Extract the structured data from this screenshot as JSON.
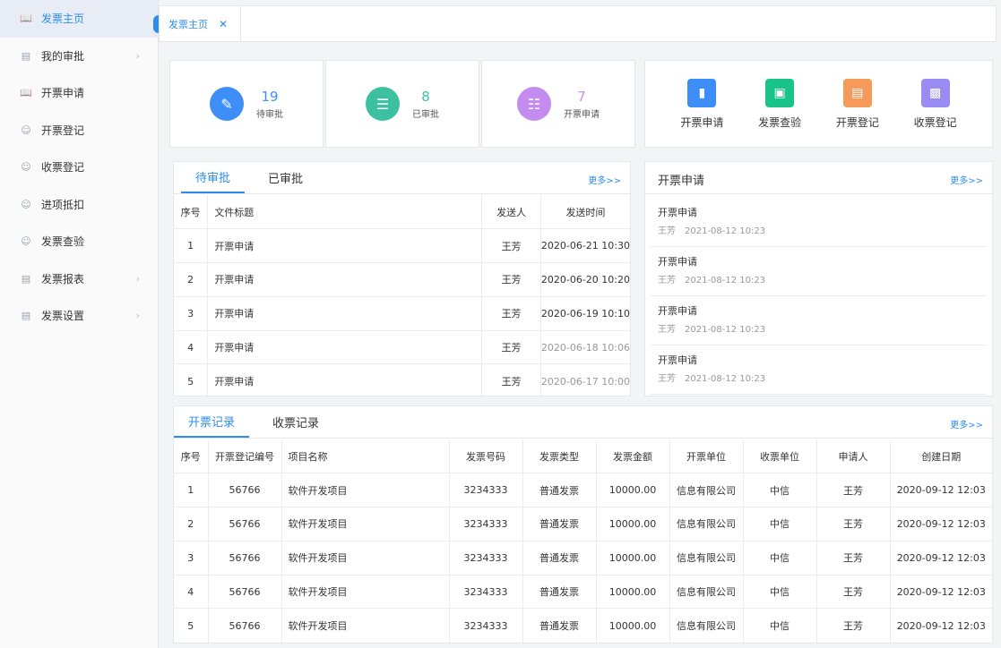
{
  "sidebar": {
    "items": [
      {
        "label": "发票主页",
        "icon": "book-icon",
        "active": true,
        "chevron": false
      },
      {
        "label": "我的审批",
        "icon": "doc-icon",
        "active": false,
        "chevron": true
      },
      {
        "label": "开票申请",
        "icon": "book-icon",
        "active": false,
        "chevron": false
      },
      {
        "label": "开票登记",
        "icon": "user-icon",
        "active": false,
        "chevron": false
      },
      {
        "label": "收票登记",
        "icon": "user-icon",
        "active": false,
        "chevron": false
      },
      {
        "label": "进项抵扣",
        "icon": "user-icon",
        "active": false,
        "chevron": false
      },
      {
        "label": "发票查验",
        "icon": "user-icon",
        "active": false,
        "chevron": false
      },
      {
        "label": "发票报表",
        "icon": "doc-icon",
        "active": false,
        "chevron": true
      },
      {
        "label": "发票设置",
        "icon": "doc-icon",
        "active": false,
        "chevron": true
      }
    ]
  },
  "tabs": [
    {
      "label": "发票主页",
      "close": "✕"
    }
  ],
  "stats": [
    {
      "value": "19",
      "label": "待审批",
      "color": "#3d8ef8"
    },
    {
      "value": "8",
      "label": "已审批",
      "color": "#3cc0a0"
    },
    {
      "value": "7",
      "label": "开票申请",
      "color": "#c58cf0"
    }
  ],
  "shortcuts": [
    {
      "label": "开票申请",
      "color": "#3d8ef8"
    },
    {
      "label": "发票查验",
      "color": "#19c38a"
    },
    {
      "label": "开票登记",
      "color": "#f59a5b"
    },
    {
      "label": "收票登记",
      "color": "#9b8cf5"
    }
  ],
  "approval": {
    "tabs": [
      "待审批",
      "已审批"
    ],
    "more": "更多>>",
    "headers": [
      "序号",
      "文件标题",
      "发送人",
      "发送时间"
    ],
    "rows": [
      [
        "1",
        "开票申请",
        "王芳",
        "2020-06-21 10:30"
      ],
      [
        "2",
        "开票申请",
        "王芳",
        "2020-06-20 10:20"
      ],
      [
        "3",
        "开票申请",
        "王芳",
        "2020-06-19 10:10"
      ],
      [
        "4",
        "开票申请",
        "王芳",
        "2020-06-18 10:06"
      ],
      [
        "5",
        "开票申请",
        "王芳",
        "2020-06-17 10:00"
      ]
    ]
  },
  "apply": {
    "title": "开票申请",
    "more": "更多>>",
    "items": [
      {
        "title": "开票申请",
        "user": "王芳",
        "time": "2021-08-12 10:23"
      },
      {
        "title": "开票申请",
        "user": "王芳",
        "time": "2021-08-12 10:23"
      },
      {
        "title": "开票申请",
        "user": "王芳",
        "time": "2021-08-12 10:23"
      },
      {
        "title": "开票申请",
        "user": "王芳",
        "time": "2021-08-12 10:23"
      }
    ]
  },
  "records": {
    "tabs": [
      "开票记录",
      "收票记录"
    ],
    "more": "更多>>",
    "headers": [
      "序号",
      "开票登记编号",
      "项目名称",
      "发票号码",
      "发票类型",
      "发票金额",
      "开票单位",
      "收票单位",
      "申请人",
      "创建日期"
    ],
    "rows": [
      [
        "1",
        "56766",
        "软件开发项目",
        "3234333",
        "普通发票",
        "10000.00",
        "信息有限公司",
        "中信",
        "王芳",
        "2020-09-12  12:03"
      ],
      [
        "2",
        "56766",
        "软件开发项目",
        "3234333",
        "普通发票",
        "10000.00",
        "信息有限公司",
        "中信",
        "王芳",
        "2020-09-12  12:03"
      ],
      [
        "3",
        "56766",
        "软件开发项目",
        "3234333",
        "普通发票",
        "10000.00",
        "信息有限公司",
        "中信",
        "王芳",
        "2020-09-12  12:03"
      ],
      [
        "4",
        "56766",
        "软件开发项目",
        "3234333",
        "普通发票",
        "10000.00",
        "信息有限公司",
        "中信",
        "王芳",
        "2020-09-12  12:03"
      ],
      [
        "5",
        "56766",
        "软件开发项目",
        "3234333",
        "普通发票",
        "10000.00",
        "信息有限公司",
        "中信",
        "王芳",
        "2020-09-12  12:03"
      ]
    ]
  }
}
